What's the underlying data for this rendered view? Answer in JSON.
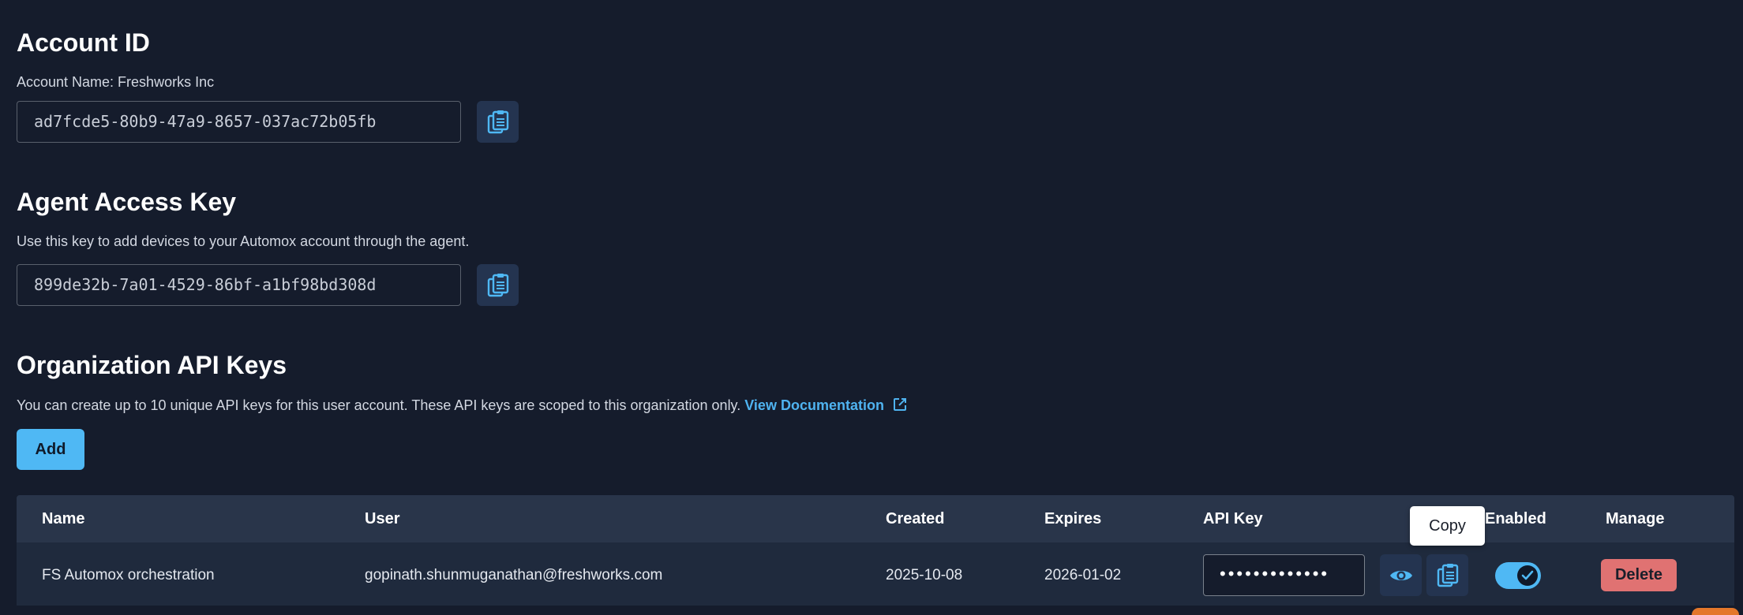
{
  "account_id": {
    "title": "Account ID",
    "account_name": "Account Name: Freshworks Inc",
    "value": "ad7fcde5-80b9-47a9-8657-037ac72b05fb"
  },
  "agent_access_key": {
    "title": "Agent Access Key",
    "description": "Use this key to add devices to your Automox account through the agent.",
    "value": "899de32b-7a01-4529-86bf-a1bf98bd308d"
  },
  "org_api_keys": {
    "title": "Organization API Keys",
    "description": "You can create up to 10 unique API keys for this user account. These API keys are scoped to this organization only.",
    "doc_link": "View Documentation",
    "add_label": "Add",
    "columns": {
      "name": "Name",
      "user": "User",
      "created": "Created",
      "expires": "Expires",
      "api_key": "API Key",
      "enabled": "Enabled",
      "manage": "Manage"
    },
    "rows": [
      {
        "name": "FS Automox orchestration",
        "user": "gopinath.shunmuganathan@freshworks.com",
        "created": "2025-10-08",
        "expires": "2026-01-02",
        "api_key_masked": "•••••••••••••",
        "enabled": true,
        "delete_label": "Delete"
      }
    ],
    "tooltip": "Copy"
  },
  "colors": {
    "background": "#151c2c",
    "accent": "#4fb8f4",
    "link": "#4fb3f0",
    "danger": "#e07272",
    "table_header": "#29354a",
    "table_row": "#1f2a3d",
    "icon_button": "#243450"
  },
  "icons": {
    "copy": "clipboard-copy-icon",
    "view": "eye-icon",
    "external": "external-link-icon",
    "check": "checkmark-icon"
  }
}
